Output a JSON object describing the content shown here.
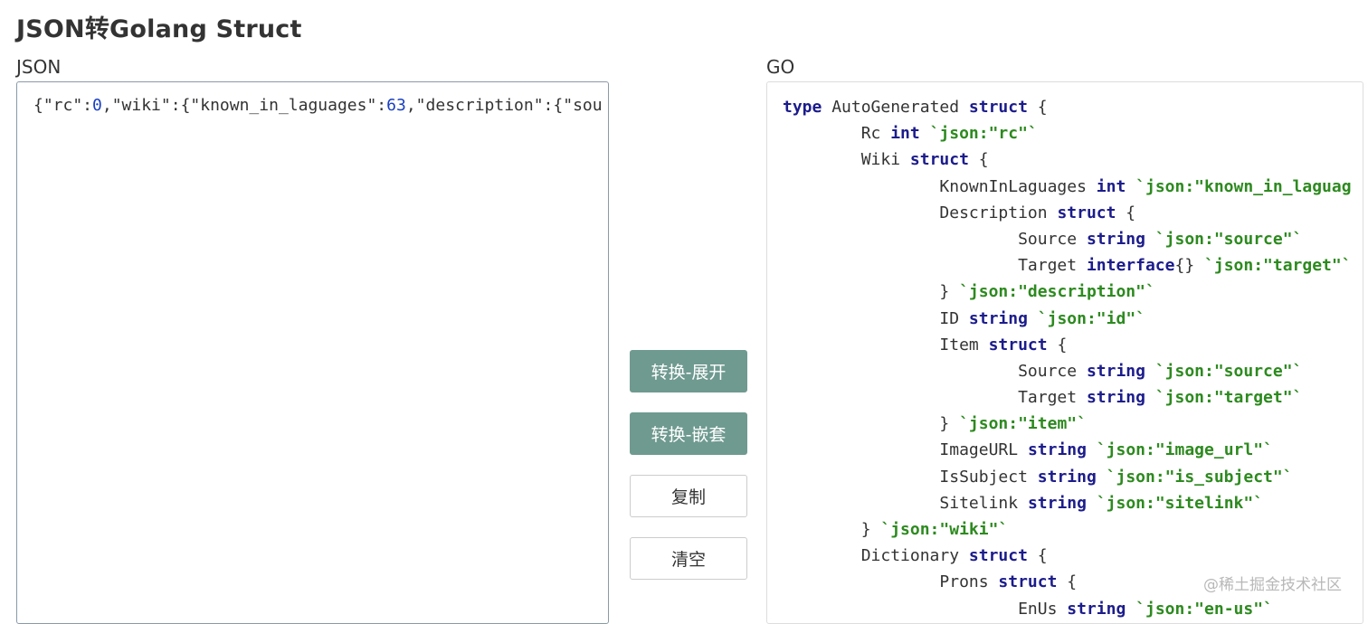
{
  "page": {
    "title": "JSON转Golang Struct"
  },
  "json_panel": {
    "label": "JSON",
    "input": {
      "prefix1": "{\"rc\":",
      "num1": "0",
      "mid": ",\"wiki\":{\"known_in_laguages\":",
      "num2": "63",
      "suffix": ",\"description\":{\"sou"
    }
  },
  "buttons": {
    "convert_expand": "转换-展开",
    "convert_nested": "转换-嵌套",
    "copy": "复制",
    "clear": "清空"
  },
  "go_panel": {
    "label": "GO",
    "lines": [
      [
        {
          "t": "type",
          "c": "kw"
        },
        {
          "t": " AutoGenerated ",
          "c": ""
        },
        {
          "t": "struct",
          "c": "kw"
        },
        {
          "t": " {",
          "c": ""
        }
      ],
      [
        {
          "t": "\tRc ",
          "c": ""
        },
        {
          "t": "int",
          "c": "kw"
        },
        {
          "t": " ",
          "c": ""
        },
        {
          "t": "`json:\"rc\"`",
          "c": "tag"
        }
      ],
      [
        {
          "t": "\tWiki ",
          "c": ""
        },
        {
          "t": "struct",
          "c": "kw"
        },
        {
          "t": " {",
          "c": ""
        }
      ],
      [
        {
          "t": "\t\tKnownInLaguages ",
          "c": ""
        },
        {
          "t": "int",
          "c": "kw"
        },
        {
          "t": " ",
          "c": ""
        },
        {
          "t": "`json:\"known_in_laguag",
          "c": "tag"
        }
      ],
      [
        {
          "t": "\t\tDescription ",
          "c": ""
        },
        {
          "t": "struct",
          "c": "kw"
        },
        {
          "t": " {",
          "c": ""
        }
      ],
      [
        {
          "t": "\t\t\tSource ",
          "c": ""
        },
        {
          "t": "string",
          "c": "kw"
        },
        {
          "t": " ",
          "c": ""
        },
        {
          "t": "`json:\"source\"`",
          "c": "tag"
        }
      ],
      [
        {
          "t": "\t\t\tTarget ",
          "c": ""
        },
        {
          "t": "interface",
          "c": "kw"
        },
        {
          "t": "{} ",
          "c": ""
        },
        {
          "t": "`json:\"target\"`",
          "c": "tag"
        }
      ],
      [
        {
          "t": "\t\t} ",
          "c": ""
        },
        {
          "t": "`json:\"description\"`",
          "c": "tag"
        }
      ],
      [
        {
          "t": "\t\tID ",
          "c": ""
        },
        {
          "t": "string",
          "c": "kw"
        },
        {
          "t": " ",
          "c": ""
        },
        {
          "t": "`json:\"id\"`",
          "c": "tag"
        }
      ],
      [
        {
          "t": "\t\tItem ",
          "c": ""
        },
        {
          "t": "struct",
          "c": "kw"
        },
        {
          "t": " {",
          "c": ""
        }
      ],
      [
        {
          "t": "\t\t\tSource ",
          "c": ""
        },
        {
          "t": "string",
          "c": "kw"
        },
        {
          "t": " ",
          "c": ""
        },
        {
          "t": "`json:\"source\"`",
          "c": "tag"
        }
      ],
      [
        {
          "t": "\t\t\tTarget ",
          "c": ""
        },
        {
          "t": "string",
          "c": "kw"
        },
        {
          "t": " ",
          "c": ""
        },
        {
          "t": "`json:\"target\"`",
          "c": "tag"
        }
      ],
      [
        {
          "t": "\t\t} ",
          "c": ""
        },
        {
          "t": "`json:\"item\"`",
          "c": "tag"
        }
      ],
      [
        {
          "t": "\t\tImageURL ",
          "c": ""
        },
        {
          "t": "string",
          "c": "kw"
        },
        {
          "t": " ",
          "c": ""
        },
        {
          "t": "`json:\"image_url\"`",
          "c": "tag"
        }
      ],
      [
        {
          "t": "\t\tIsSubject ",
          "c": ""
        },
        {
          "t": "string",
          "c": "kw"
        },
        {
          "t": " ",
          "c": ""
        },
        {
          "t": "`json:\"is_subject\"`",
          "c": "tag"
        }
      ],
      [
        {
          "t": "\t\tSitelink ",
          "c": ""
        },
        {
          "t": "string",
          "c": "kw"
        },
        {
          "t": " ",
          "c": ""
        },
        {
          "t": "`json:\"sitelink\"`",
          "c": "tag"
        }
      ],
      [
        {
          "t": "\t} ",
          "c": ""
        },
        {
          "t": "`json:\"wiki\"`",
          "c": "tag"
        }
      ],
      [
        {
          "t": "\tDictionary ",
          "c": ""
        },
        {
          "t": "struct",
          "c": "kw"
        },
        {
          "t": " {",
          "c": ""
        }
      ],
      [
        {
          "t": "\t\tProns ",
          "c": ""
        },
        {
          "t": "struct",
          "c": "kw"
        },
        {
          "t": " {",
          "c": ""
        }
      ],
      [
        {
          "t": "\t\t\tEnUs ",
          "c": ""
        },
        {
          "t": "string",
          "c": "kw"
        },
        {
          "t": " ",
          "c": ""
        },
        {
          "t": "`json:\"en-us\"`",
          "c": "tag"
        }
      ]
    ]
  },
  "watermark": "@稀土掘金技术社区"
}
